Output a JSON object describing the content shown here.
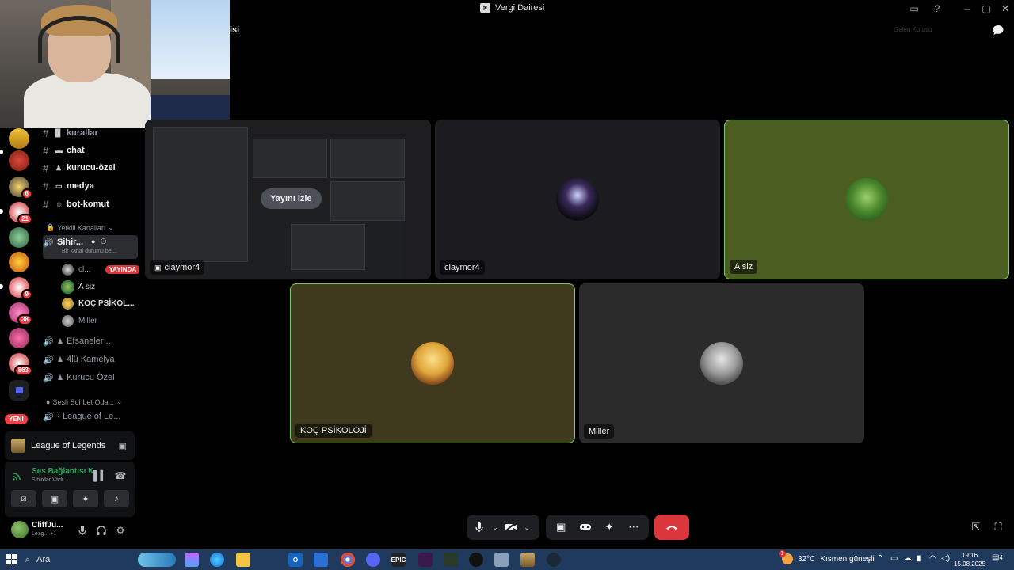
{
  "window": {
    "title": "Vergi Dairesi"
  },
  "header": {
    "channel_fragment": "isi",
    "right_text": "Gelen Kutusu"
  },
  "rail": {
    "badges": [
      "6",
      "21",
      "9",
      "38",
      "863"
    ],
    "new_label": "YENİ"
  },
  "channels": {
    "text": [
      {
        "name": "kurallar"
      },
      {
        "name": "chat"
      },
      {
        "name": "kurucu-özel"
      },
      {
        "name": "medya"
      },
      {
        "name": "bot-komut"
      }
    ],
    "category_staff": "Yetkili Kanalları",
    "active_voice": {
      "name": "Sihir...",
      "status": "Bir kanal durumu bel..."
    },
    "members": [
      {
        "name": "cl...",
        "live": "YAYINDA"
      },
      {
        "name": "A siz"
      },
      {
        "name": "KOÇ PSİKOL..."
      },
      {
        "name": "Miller"
      }
    ],
    "voice": [
      "Efsaneler ...",
      "4lü Kamelya",
      "Kurucu Özel"
    ],
    "category_voice": "Sesli Sohbet Oda...",
    "voice_extra": "League of Le..."
  },
  "game_panel": {
    "title": "League of Legends"
  },
  "voice_panel": {
    "status": "Ses Bağlantısı K",
    "channel": "Sihirdar Vadi..."
  },
  "user_panel": {
    "name": "CliffJu...",
    "activity": "Leag... +1"
  },
  "tiles": {
    "stream": {
      "label": "claymor4",
      "watch_button": "Yayını izle"
    },
    "claymor": {
      "label": "claymor4"
    },
    "a_siz": {
      "label": "A siz"
    },
    "koc": {
      "label": "KOÇ PSİKOLOJİ"
    },
    "miller": {
      "label": "Miller"
    }
  },
  "taskbar": {
    "search": "Ara",
    "weather_temp": "32°C",
    "weather_text": "Kısmen güneşli",
    "weather_badge": "1",
    "time": "19:16",
    "date": "15.08.2025",
    "notif_count": "4"
  },
  "colors": {
    "accent_green": "#23a55a",
    "danger": "#da373c",
    "tile_asiz": "#4a5e22",
    "tile_koc": "#3f3a1e",
    "tile_miller": "#2b2b2b",
    "tile_claymor": "#1c1b20"
  }
}
